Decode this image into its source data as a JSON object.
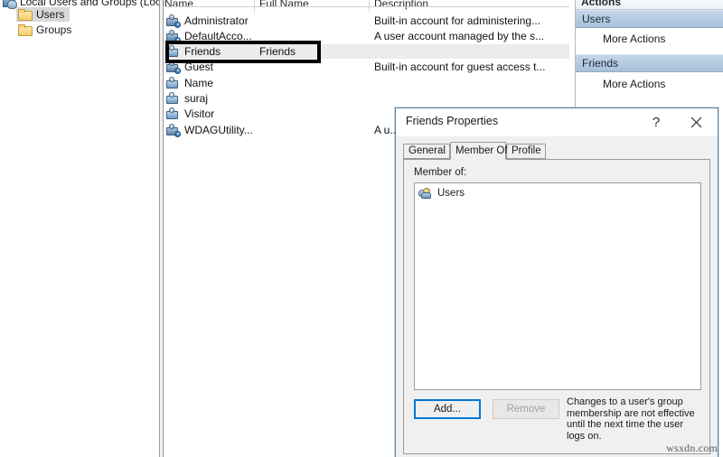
{
  "tree": {
    "root_label": "Local Users and Groups (Local)",
    "items": [
      {
        "label": "Users",
        "selected": true
      },
      {
        "label": "Groups",
        "selected": false
      }
    ]
  },
  "list": {
    "columns": [
      "Name",
      "Full Name",
      "Description"
    ],
    "rows": [
      {
        "name": "Administrator",
        "full_name": "",
        "description": "Built-in account for administering...",
        "disabled": true,
        "selected": false
      },
      {
        "name": "DefaultAcco...",
        "full_name": "",
        "description": "A user account managed by the s...",
        "disabled": true,
        "selected": false
      },
      {
        "name": "Friends",
        "full_name": "Friends",
        "description": "",
        "disabled": false,
        "selected": true
      },
      {
        "name": "Guest",
        "full_name": "",
        "description": "Built-in account for guest access t...",
        "disabled": true,
        "selected": false
      },
      {
        "name": "Name",
        "full_name": "",
        "description": "",
        "disabled": false,
        "selected": false
      },
      {
        "name": "suraj",
        "full_name": "",
        "description": "",
        "disabled": false,
        "selected": false
      },
      {
        "name": "Visitor",
        "full_name": "",
        "description": "",
        "disabled": false,
        "selected": false
      },
      {
        "name": "WDAGUtility...",
        "full_name": "",
        "description": "A u...",
        "disabled": true,
        "selected": false
      }
    ]
  },
  "actions": {
    "title": "Actions",
    "groups": [
      {
        "header": "Users",
        "items": [
          "More Actions"
        ]
      },
      {
        "header": "Friends",
        "items": [
          "More Actions"
        ]
      }
    ]
  },
  "dialog": {
    "title": "Friends Properties",
    "help_glyph": "?",
    "close_glyph": "✕",
    "tabs": [
      {
        "label": "General",
        "active": false
      },
      {
        "label": "Member Of",
        "active": true
      },
      {
        "label": "Profile",
        "active": false
      }
    ],
    "member_of_label": "Member of:",
    "member_of_list": [
      "Users"
    ],
    "add_button": "Add...",
    "remove_button": "Remove",
    "note": "Changes to a user's group membership are not effective until the next time the user logs on."
  },
  "watermark": "wsxdn.com",
  "colors": {
    "accent_blue": "#0078d7",
    "actions_header": "#a7c1da",
    "dialog_border": "#5c7f9e",
    "selection_gray": "#ececec",
    "annotation_black": "#000000"
  }
}
